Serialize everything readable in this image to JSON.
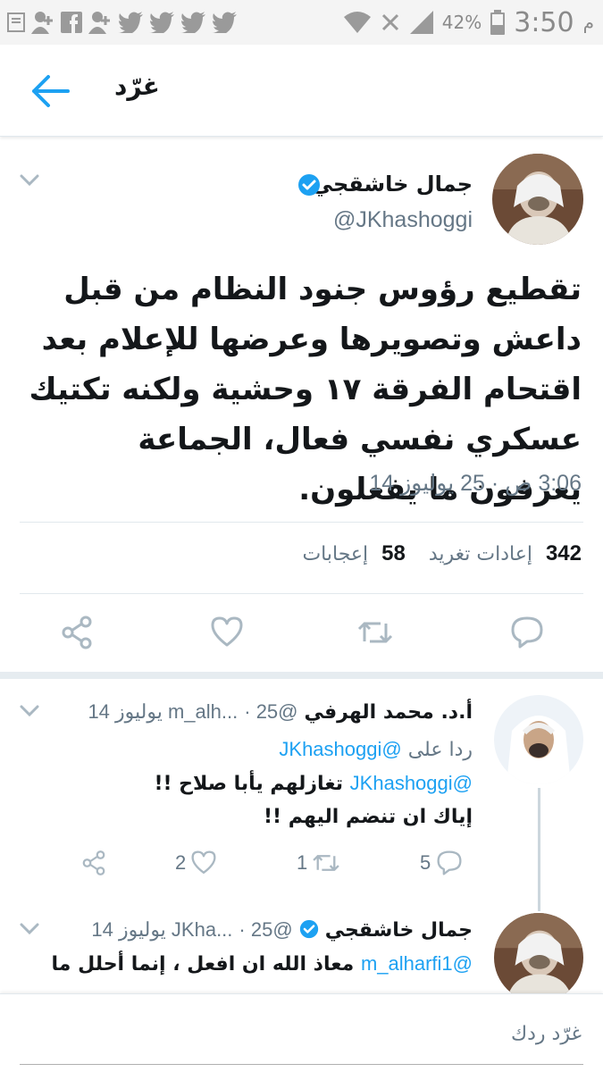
{
  "status_bar": {
    "time": "3:50",
    "ampm": "م",
    "battery_percent": "42%"
  },
  "header": {
    "title": "غرّد",
    "back_icon": "arrow-left-icon"
  },
  "tweet": {
    "author_name": "جمال خاشقجي",
    "handle": "@JKhashoggi",
    "verified": true,
    "text": "تقطيع رؤوس جنود النظام من قبل داعش وتصويرها وعرضها للإعلام بعد اقتحام الفرقة ١٧ وحشية ولكنه تكتيك عسكري نفسي فعال، الجماعة يعرفون ما يفعلون.",
    "date": "3:06 ص · 25 يوليوز 14",
    "retweets_count": "342",
    "retweets_label": "إعادات تغريد",
    "likes_count": "58",
    "likes_label": "إعجابات"
  },
  "replies": [
    {
      "name": "أ.د. محمد الهرفي",
      "handle": "@m_alh...",
      "date": "25 يوليوز 14",
      "reply_to_label": "ردا على",
      "reply_to_handle": "@JKhashoggi",
      "mention": "@JKhashoggi",
      "line1": "تغازلهم يأبا صلاح !!",
      "line2": "إياك ان تنضم اليهم !!",
      "replies_count": "5",
      "retweets_count": "1",
      "likes_count": "2"
    },
    {
      "name": "جمال خاشقجي",
      "handle": "@JKha...",
      "date": "25 يوليوز 14",
      "mention": "@m_alharfi1",
      "line1": "معاذ الله ان افعل ، إنما أحلل ما"
    }
  ],
  "composer": {
    "placeholder": "غرّد ردك"
  },
  "colors": {
    "accent": "#1da1f2",
    "text": "#14171a",
    "muted": "#657786",
    "divider": "#e1e8ed"
  }
}
